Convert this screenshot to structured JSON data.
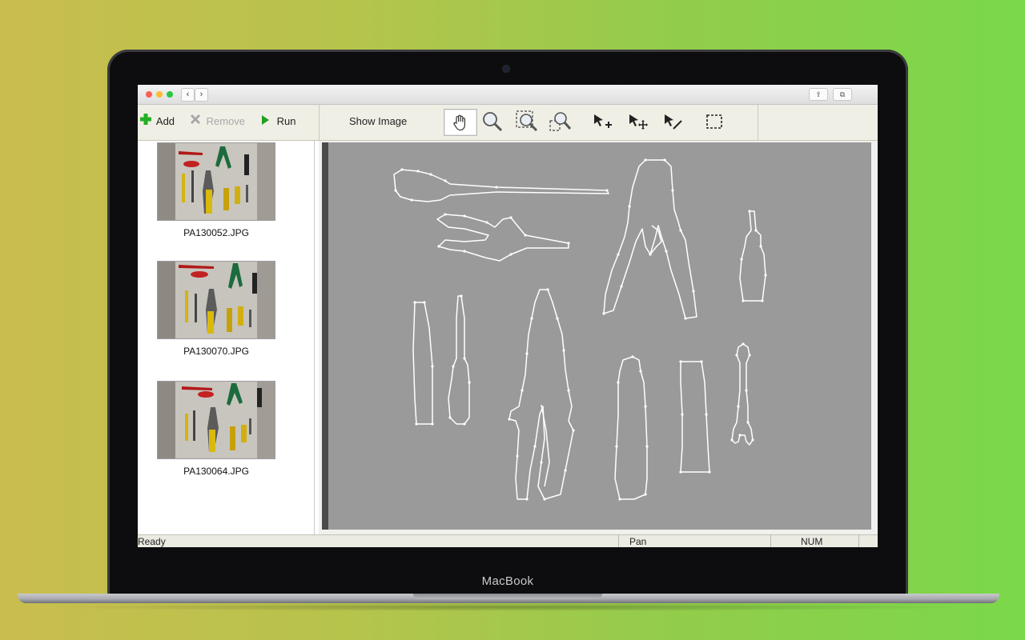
{
  "device": {
    "brand_label": "MacBook"
  },
  "window": {
    "traffic_lights": {
      "close": "#fc5f57",
      "minimize": "#fdbc2e",
      "zoom": "#28c840"
    },
    "nav": {
      "back": "‹",
      "forward": "›"
    },
    "right_buttons": [
      "share-icon",
      "tabs-icon"
    ]
  },
  "toolbar": {
    "add_label": "Add",
    "remove_label": "Remove",
    "run_label": "Run",
    "show_image_label": "Show Image",
    "tools": [
      "pan-hand-icon",
      "zoom-icon",
      "zoom-region-icon",
      "zoom-out-icon",
      "add-point-icon",
      "move-point-icon",
      "delete-point-icon",
      "select-rect-icon"
    ],
    "active_tool": "pan-hand-icon"
  },
  "images": [
    {
      "filename": "PA130052.JPG"
    },
    {
      "filename": "PA130070.JPG"
    },
    {
      "filename": "PA130064.JPG"
    }
  ],
  "status": {
    "left": "Ready",
    "mode": "Pan",
    "num": "NUM"
  },
  "colors": {
    "add_icon": "#22b022",
    "remove_icon": "#a6a6a6",
    "run_icon": "#20a020",
    "canvas_bg": "#9a9a9a",
    "outline": "#ffffff"
  }
}
